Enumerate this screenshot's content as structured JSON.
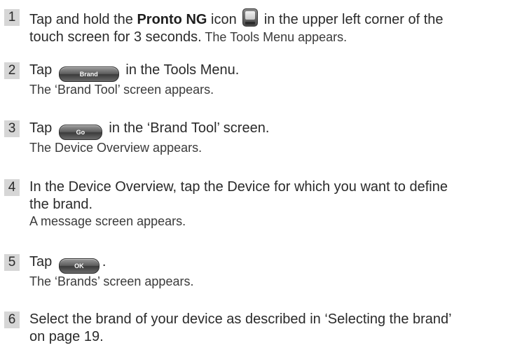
{
  "steps": [
    {
      "number": "1",
      "l1_a": "Tap and hold the ",
      "l1_b": "Pronto NG",
      "l1_c": " icon ",
      "l1_d": " in the upper left corner of the",
      "l2_a": "touch screen for 3 seconds.",
      "l2_b": " The Tools Menu appears.",
      "icon": "pronto-device-icon"
    },
    {
      "number": "2",
      "l1_a": "Tap ",
      "button": "Brand",
      "l1_b": " in the Tools Menu.",
      "sub": "The ‘Brand Tool’ screen appears."
    },
    {
      "number": "3",
      "l1_a": "Tap ",
      "button": "Go",
      "l1_b": " in the ‘Brand Tool’ screen.",
      "sub": "The Device Overview appears."
    },
    {
      "number": "4",
      "l1": "In the Device Overview, tap the Device for which you want to define",
      "l2": "the brand.",
      "sub": "A message screen appears."
    },
    {
      "number": "5",
      "l1_a": "Tap ",
      "button": "OK",
      "l1_b": ".",
      "sub": "The ‘Brands’ screen appears."
    },
    {
      "number": "6",
      "l1": "Select the brand of your device as described in ‘Selecting the brand’",
      "l2": "on page 19."
    }
  ]
}
